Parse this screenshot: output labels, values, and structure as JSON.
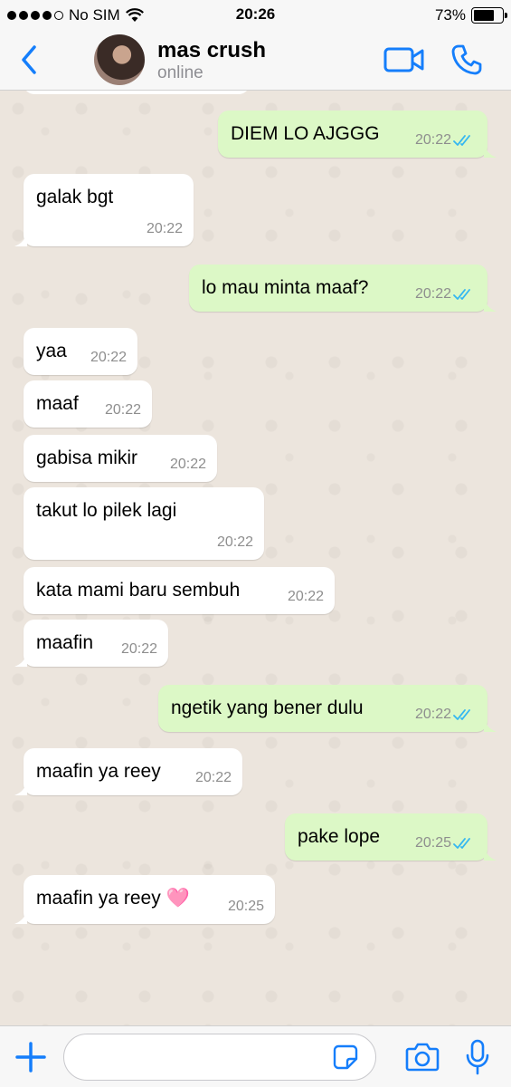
{
  "status_bar": {
    "carrier": "No SIM",
    "time": "20:26",
    "battery": "73%",
    "battery_level": 0.73
  },
  "header": {
    "contact_name": "mas crush",
    "contact_status": "online",
    "icons": [
      "back-chevron-icon",
      "avatar",
      "video-call-icon",
      "phone-icon"
    ]
  },
  "messages": [
    {
      "dir": "out",
      "text": "DIEM LO AJGGG",
      "time": "20:22",
      "read": true
    },
    {
      "dir": "in",
      "text": "galak bgt",
      "time": "20:22"
    },
    {
      "dir": "out",
      "text": "lo mau minta maaf?",
      "time": "20:22",
      "read": true
    },
    {
      "dir": "in",
      "text": "yaa",
      "time": "20:22"
    },
    {
      "dir": "in",
      "text": "maaf",
      "time": "20:22"
    },
    {
      "dir": "in",
      "text": "gabisa mikir",
      "time": "20:22"
    },
    {
      "dir": "in",
      "text": "takut lo pilek lagi",
      "time": "20:22"
    },
    {
      "dir": "in",
      "text": "kata mami baru sembuh",
      "time": "20:22"
    },
    {
      "dir": "in",
      "text": "maafin",
      "time": "20:22"
    },
    {
      "dir": "out",
      "text": "ngetik yang bener dulu",
      "time": "20:22",
      "read": true
    },
    {
      "dir": "in",
      "text": "maafin ya reey",
      "time": "20:22"
    },
    {
      "dir": "out",
      "text": "pake lope",
      "time": "20:25",
      "read": true
    },
    {
      "dir": "in",
      "text": "maafin ya reey 🩷",
      "time": "20:25"
    }
  ],
  "input_bar": {
    "message_value": "",
    "icons": [
      "plus-icon",
      "sticker-icon",
      "camera-icon",
      "microphone-icon"
    ]
  },
  "colors": {
    "accent": "#157efb",
    "outgoing_bubble": "#dcf8c6",
    "incoming_bubble": "#ffffff",
    "chat_background": "#ece5dd",
    "read_ticks": "#34b7f1"
  }
}
